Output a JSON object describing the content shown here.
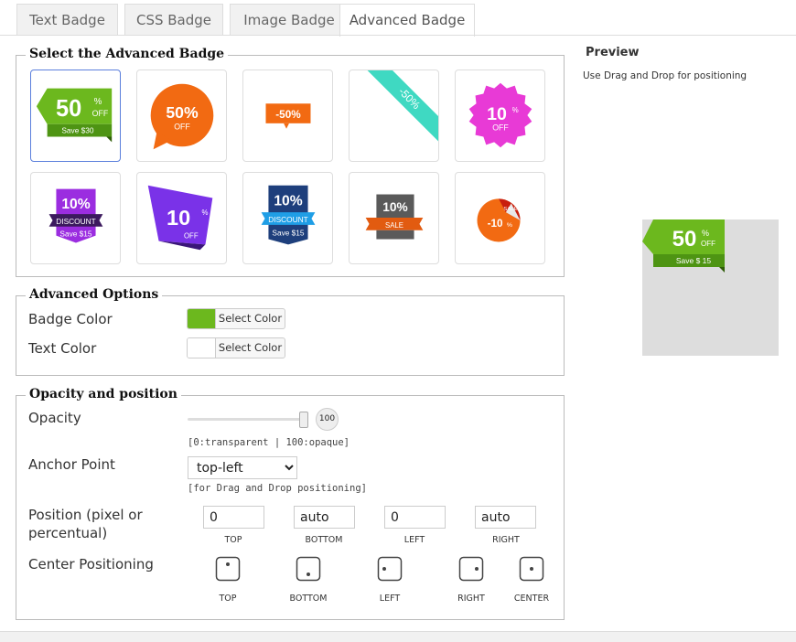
{
  "tabs": [
    {
      "label": "Text Badge"
    },
    {
      "label": "CSS Badge"
    },
    {
      "label": "Image Badge"
    },
    {
      "label": "Advanced Badge"
    }
  ],
  "select_section": {
    "legend": "Select the Advanced Badge",
    "badges": [
      {
        "name": "ribbon-green",
        "big": "50",
        "sup": "%",
        "sub": "OFF",
        "foot": "Save $30"
      },
      {
        "name": "bubble-orange",
        "big": "50%",
        "sub": "OFF"
      },
      {
        "name": "tag-orange",
        "big": "-50%"
      },
      {
        "name": "corner-teal",
        "big": "-50%"
      },
      {
        "name": "starburst-pink",
        "big": "10",
        "sup": "%",
        "sub": "OFF"
      },
      {
        "name": "banner-purple",
        "big": "10%",
        "mid": "DISCOUNT",
        "foot": "Save $15"
      },
      {
        "name": "flag-purple",
        "big": "10",
        "sup": "%",
        "sub": "OFF"
      },
      {
        "name": "banner-navy",
        "big": "10%",
        "mid": "DISCOUNT",
        "foot": "Save $15"
      },
      {
        "name": "ribbon-sale",
        "big": "10%",
        "mid": "SALE"
      },
      {
        "name": "sticker-peel",
        "big": "-10",
        "sup": "%",
        "mid": "SALE!"
      }
    ]
  },
  "advanced_options": {
    "legend": "Advanced Options",
    "badge_color_label": "Badge Color",
    "text_color_label": "Text Color",
    "select_color_label": "Select Color",
    "badge_color": "#6cb81e",
    "text_color": "#ffffff"
  },
  "opacity_section": {
    "legend": "Opacity and position",
    "opacity_label": "Opacity",
    "opacity_value": "100",
    "opacity_hint": "[0:transparent | 100:opaque]",
    "anchor_label": "Anchor Point",
    "anchor_value": "top-left",
    "anchor_hint": "[for Drag and Drop positioning]",
    "position_label": "Position (pixel or percentual)",
    "position_values": {
      "top": "0",
      "bottom": "auto",
      "left": "0",
      "right": "auto"
    },
    "position_captions": {
      "top": "TOP",
      "bottom": "BOTTOM",
      "left": "LEFT",
      "right": "RIGHT"
    },
    "center_label": "Center Positioning",
    "center_captions": {
      "top": "TOP",
      "bottom": "BOTTOM",
      "left": "LEFT",
      "right": "RIGHT",
      "center": "CENTER"
    }
  },
  "preview": {
    "title": "Preview",
    "description": "Use Drag and Drop for positioning",
    "badge": {
      "big": "50",
      "sup": "%",
      "sub": "OFF",
      "foot": "Save $ 15"
    }
  },
  "colors": {
    "green": "#6cb81e",
    "orange": "#f26a12",
    "teal": "#3fd9c2",
    "magenta": "#e83ad6",
    "purple": "#9b2de0",
    "navy": "#1e3f7c",
    "sky": "#1f9ee6"
  }
}
